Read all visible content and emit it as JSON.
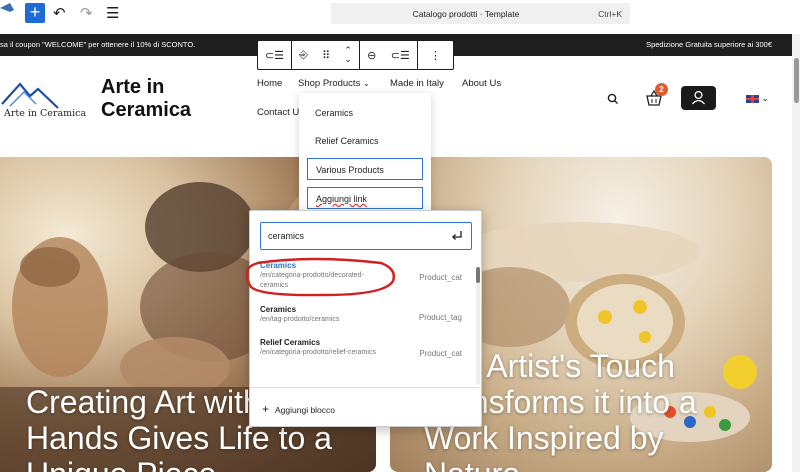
{
  "editor": {
    "document_title": "Catalogo prodotti · Template",
    "shortcut": "Ctrl+K"
  },
  "promo": {
    "left_text": "sa il coupon  \"WELCOME\" per ottenere il 10% di SCONTO.",
    "right_text": "Spedizione Gratuita superiore ai 300€"
  },
  "site": {
    "logo_text": "Arte in Ceramica",
    "name": "Arte in Ceramica",
    "cart_count": "2"
  },
  "nav": {
    "items": [
      "Home",
      "Shop Products",
      "Made in Italy",
      "About Us",
      "Contact U"
    ]
  },
  "submenu": {
    "items": [
      "Ceramics",
      "Relief Ceramics",
      "Various Products",
      "Aggiungi link"
    ]
  },
  "link_search": {
    "query": "ceramics",
    "results": [
      {
        "title": "Ceramics",
        "url": "/en/categoria-prodotto/decorated-ceramics",
        "type": "Product_cat"
      },
      {
        "title": "Ceramics",
        "url": "/en/tag-prodotto/ceramics",
        "type": "Product_tag"
      },
      {
        "title": "Relief Ceramics",
        "url": "/en/categoria-prodotto/relief-ceramics",
        "type": "Product_cat"
      }
    ],
    "add_block_label": "Aggiungi blocco"
  },
  "hero": {
    "left_title_lines": [
      "Creating Art with",
      "Hands Gives Life to a",
      "Unique Piece"
    ],
    "right_title_lines": [
      "The Artist's Touch",
      "Transforms it into a",
      "Work Inspired by",
      "Nature"
    ]
  },
  "colors": {
    "accent": "#1e6bd6",
    "dark_bar": "#1f1f1f",
    "badge": "#e25b2a",
    "annotation": "#d21f1f"
  }
}
